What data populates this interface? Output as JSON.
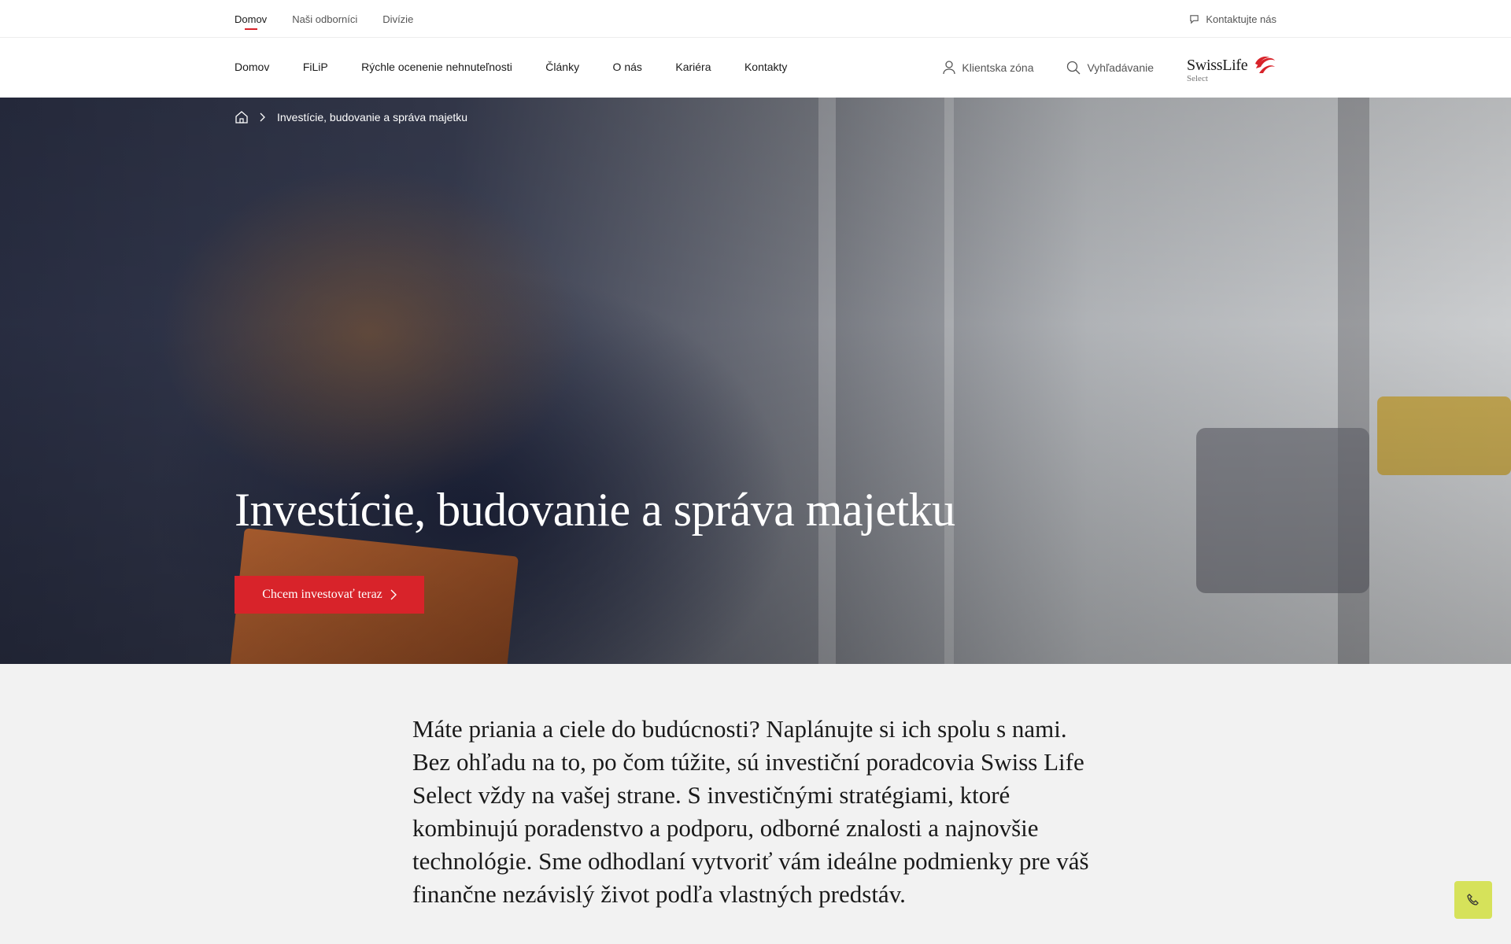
{
  "topbar": {
    "links": [
      "Domov",
      "Naši odborníci",
      "Divízie"
    ],
    "contact_label": "Kontaktujte nás",
    "contact_icon": "chat-icon"
  },
  "nav": {
    "items": [
      "Domov",
      "FiLiP",
      "Rýchle ocenenie nehnuteľnosti",
      "Články",
      "O nás",
      "Kariéra",
      "Kontakty"
    ],
    "client_zone": "Klientska zóna",
    "client_zone_icon": "user-icon",
    "search": "Vyhľadávanie",
    "search_icon": "search-icon"
  },
  "logo": {
    "wordmark": "SwissLife",
    "sub": "Select",
    "brand_color": "#d8232a"
  },
  "hero": {
    "breadcrumb_home_icon": "home-icon",
    "breadcrumb_current": "Investície, budovanie a správa majetku",
    "title": "Investície, budovanie a správa majetku",
    "cta_label": "Chcem investovať teraz",
    "cta_color": "#d8232a"
  },
  "content": {
    "intro": "Máte priania a ciele do budúcnosti? Naplánujte si ich spolu s nami. Bez ohľadu na to, po čom túžite, sú investiční poradcovia Swiss Life Select vždy na vašej strane. S investičnými stratégiami, ktoré kombinujú poradenstvo a podporu, odborné znalosti a najnovšie technológie. Sme odhodlaní vytvoriť vám ideálne podmienky pre váš finančne nezávislý život podľa vlastných predstáv."
  },
  "floating": {
    "call_icon": "phone-icon",
    "color": "#d6e25a"
  }
}
